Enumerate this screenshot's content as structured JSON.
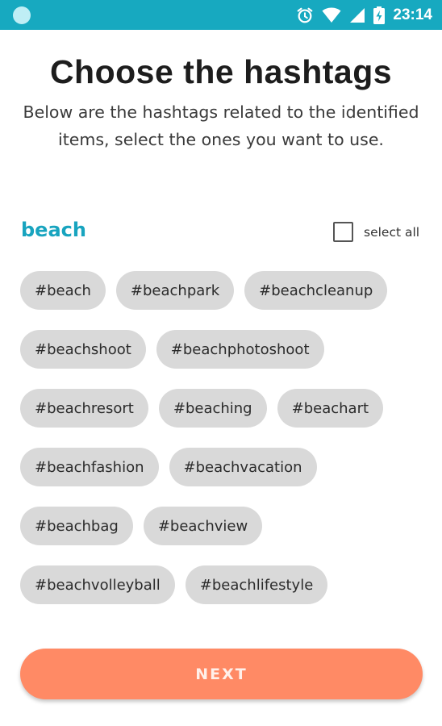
{
  "status_bar": {
    "time": "23:14",
    "icons": [
      "app-notification-icon",
      "alarm-icon",
      "wifi-icon",
      "signal-icon",
      "battery-charging-icon"
    ],
    "background": "#17a9c0"
  },
  "header": {
    "title": "Choose the hashtags",
    "subtitle": "Below are the hashtags related to the identified items, select the ones you want to use."
  },
  "section": {
    "title": "beach",
    "select_all_label": "select all",
    "select_all_checked": false,
    "accent": "#18a4bf",
    "hashtags": [
      "#beach",
      "#beachpark",
      "#beachcleanup",
      "#beachshoot",
      "#beachphotoshoot",
      "#beachresort",
      "#beaching",
      "#beachart",
      "#beachfashion",
      "#beachvacation",
      "#beachbag",
      "#beachview",
      "#beachvolleyball",
      "#beachlifestyle"
    ]
  },
  "footer": {
    "next_label": "NEXT",
    "button_color": "#ff8a65"
  }
}
